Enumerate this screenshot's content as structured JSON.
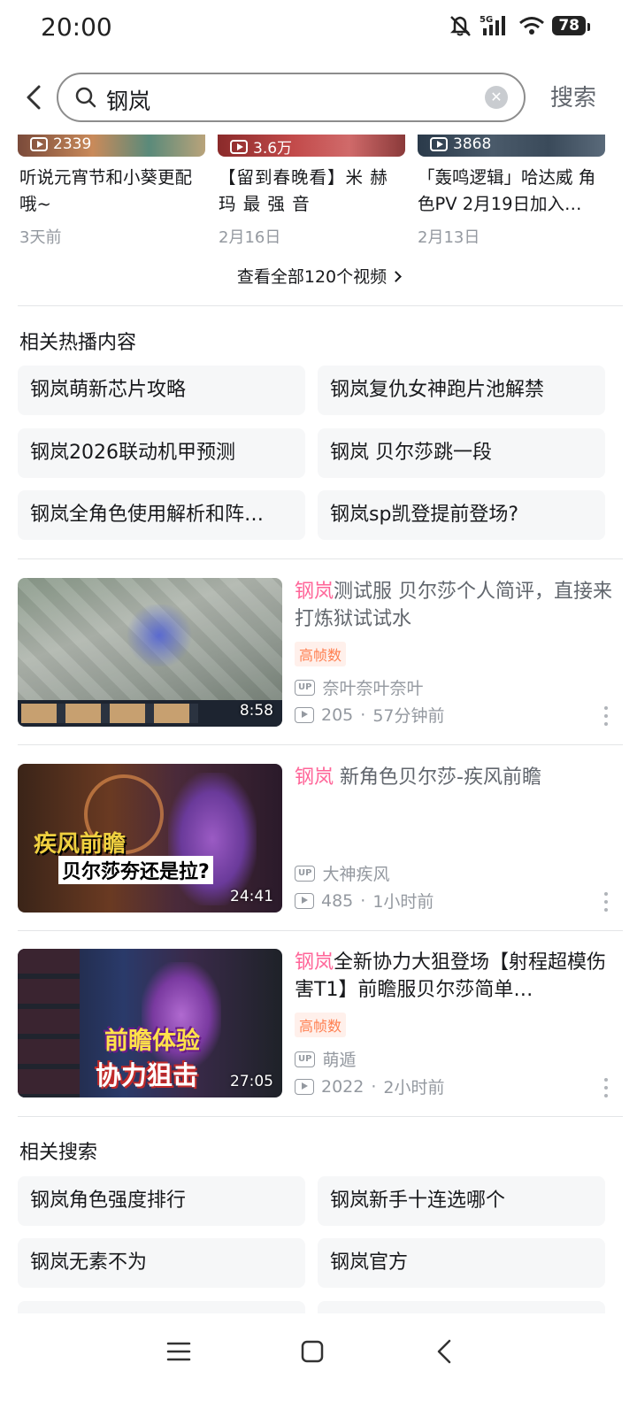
{
  "status_bar": {
    "time": "20:00",
    "network": "5G",
    "battery": "78"
  },
  "search": {
    "query": "钢岚",
    "submit_label": "搜索"
  },
  "top_videos": [
    {
      "views": "2339",
      "title": "听说元宵节和小葵更配哦~",
      "date": "3天前"
    },
    {
      "views": "3.6万",
      "title": "【留到春晚看】米 赫 玛 最 强 音",
      "date": "2月16日"
    },
    {
      "views": "3868",
      "title": "「轰鸣逻辑」哈达威 角色PV 2月19日加入…",
      "date": "2月13日"
    }
  ],
  "see_all_label": "查看全部120个视频",
  "hot_section": {
    "title": "相关热播内容",
    "items": [
      "钢岚萌新芯片攻略",
      "钢岚复仇女神跑片池解禁",
      "钢岚2026联动机甲预测",
      "钢岚 贝尔莎跳一段",
      "钢岚全角色使用解析和阵…",
      "钢岚sp凯登提前登场?"
    ]
  },
  "videos": [
    {
      "highlight": "钢岚",
      "title_rest": "测试服 贝尔莎个人简评，直接来打炼狱试试水",
      "tag": "高帧数",
      "uploader": "奈叶奈叶奈叶",
      "views": "205",
      "time": "57分钟前",
      "duration": "8:58"
    },
    {
      "highlight": "钢岚",
      "title_rest": " 新角色贝尔莎-疾风前瞻",
      "tag": "",
      "uploader": "大神疾风",
      "views": "485",
      "time": "1小时前",
      "duration": "24:41",
      "thumb_text_1": "疾风前瞻",
      "thumb_text_2": "贝尔莎夯还是拉?"
    },
    {
      "highlight": "钢岚",
      "title_rest": "全新协力大狙登场【射程超模伤害T1】前瞻服贝尔莎简单…",
      "tag": "高帧数",
      "uploader": "萌遁",
      "views": "2022",
      "time": "2小时前",
      "duration": "27:05",
      "thumb_text_1": "前瞻体验",
      "thumb_text_2": "协力狙击"
    }
  ],
  "related_section": {
    "title": "相关搜索",
    "items": [
      "钢岚角色强度排行",
      "钢岚新手十连选哪个",
      "钢岚无素不为",
      "钢岚官方"
    ]
  },
  "colors": {
    "accent_pink": "#ff6699",
    "tag_orange": "#ff7f50"
  }
}
